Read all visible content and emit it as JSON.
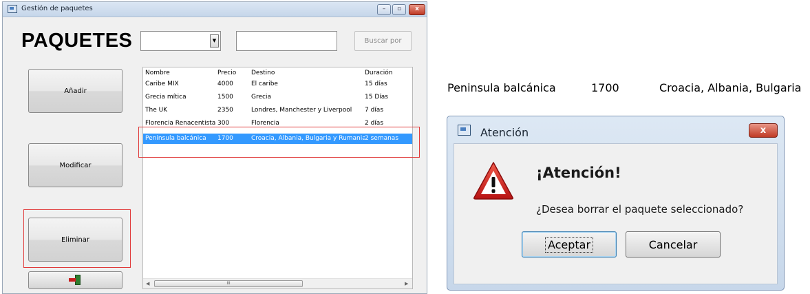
{
  "main_window": {
    "title": "Gestión de paquetes",
    "controls": {
      "minimize": "–",
      "maximize": "▫",
      "close": "x"
    }
  },
  "header": {
    "heading": "PAQUETES",
    "filter_combo_value": "",
    "search_value": "",
    "search_button": "Buscar por"
  },
  "sidebar": {
    "add_button": "Añadir",
    "modify_button": "Modificar",
    "delete_button": "Eliminar"
  },
  "table": {
    "columns": [
      "Nombre",
      "Precio",
      "Destino",
      "Duración"
    ],
    "rows": [
      [
        "Caribe MIX",
        "4000",
        "El caribe",
        "15 días"
      ],
      [
        "Grecia mítica",
        "1500",
        "Grecia",
        "15 Días"
      ],
      [
        "The UK",
        "2350",
        "Londres, Manchester y Liverpool",
        "7 días"
      ],
      [
        "Florencia Renacentista",
        "300",
        "Florencia",
        "2 días"
      ],
      [
        "Peninsula balcánica",
        "1700",
        "Croacia, Albania, Bulgaria y Rumania",
        "2 semanas"
      ]
    ],
    "selected_row": 4,
    "scrollbar_grip": "III"
  },
  "zoom_row": {
    "name": "Peninsula balcánica",
    "price": "1700",
    "destination": "Croacia, Albania, Bulgaria"
  },
  "dialog": {
    "title": "Atención",
    "close": "x",
    "heading": "¡Atención!",
    "message": "¿Desea borrar el paquete seleccionado?",
    "ok_button": "Aceptar",
    "cancel_button": "Cancelar"
  },
  "colors": {
    "selection": "#3399ff",
    "highlight": "#e03a3a",
    "warning_red": "#d11f1f"
  },
  "icons": {
    "window": "app-window-icon",
    "exit": "exit-door-icon",
    "warning": "warning-triangle-icon"
  }
}
